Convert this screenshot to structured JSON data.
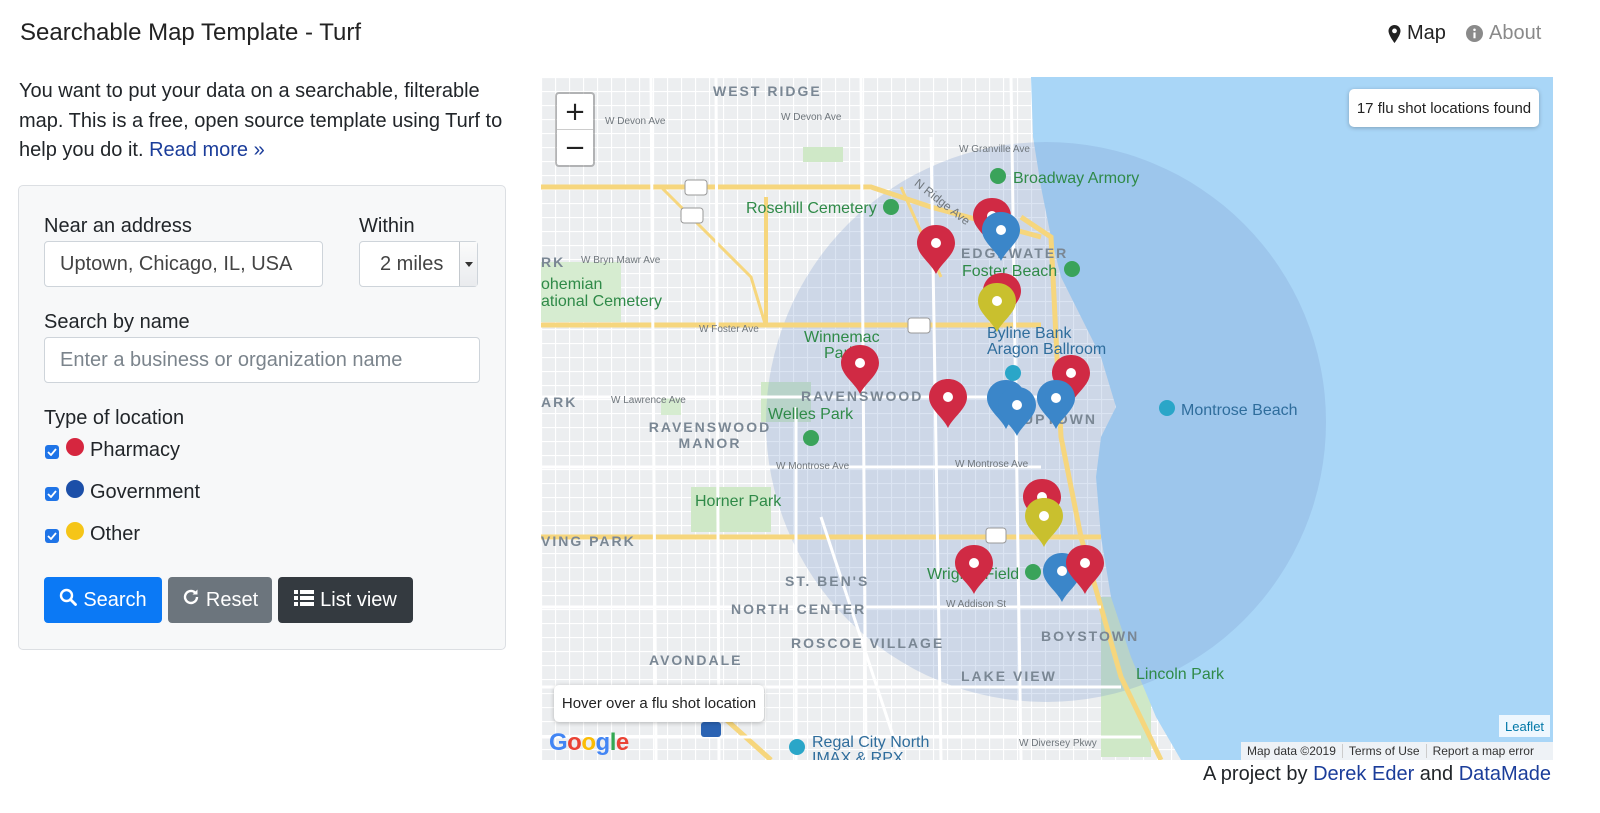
{
  "navbar": {
    "brand": "Searchable Map Template - Turf",
    "map_link": "Map",
    "about_link": "About",
    "map_icon": "map-marker-icon",
    "about_icon": "info-circle-icon"
  },
  "intro": {
    "text": "You want to put your data on a searchable, filterable map. This is a free, open source template using Turf to help you do it.",
    "read_more": "Read more »"
  },
  "form": {
    "address_label": "Near an address",
    "address_value": "Uptown, Chicago, IL, USA",
    "within_label": "Within",
    "within_value": "2 miles",
    "name_label": "Search by name",
    "name_placeholder": "Enter a business or organization name",
    "type_label": "Type of location",
    "types": [
      {
        "label": "Pharmacy",
        "color": "#d6263f",
        "checked": true
      },
      {
        "label": "Government",
        "color": "#1c4fa8",
        "checked": true
      },
      {
        "label": "Other",
        "color": "#f5c518",
        "checked": true
      }
    ],
    "search_button": "Search",
    "reset_button": "Reset",
    "list_button": "List view"
  },
  "map": {
    "result_count": "17 flu shot locations found",
    "hover_hint": "Hover over a flu shot location",
    "zoom_in": "+",
    "zoom_out": "−",
    "leaflet_attribution": "Leaflet",
    "map_data": "Map data ©2019",
    "terms": "Terms of Use",
    "report": "Report a map error",
    "google": "Google",
    "labels": {
      "west_ridge": "WEST RIDGE",
      "edgewater": "EDGEWATER",
      "ravenswood": "RAVENSWOOD",
      "ravenswood_manor": "RAVENSWOOD MANOR",
      "uptown": "UPTOWN",
      "st_bens": "ST. BEN'S",
      "north_center": "NORTH CENTER",
      "roscoe_village": "ROSCOE VILLAGE",
      "avondale": "AVONDALE",
      "lake_view": "LAKE VIEW",
      "boystown": "BOYSTOWN",
      "irving_park": "VING PARK",
      "ark1": "RK",
      "ark2": "ARK"
    },
    "pois": {
      "broadway_armory": "Broadway Armory",
      "rosehill": "Rosehill Cemetery",
      "foster_beach": "Foster Beach",
      "bohemian": "ohemian",
      "national_cemetery": "ational Cemetery",
      "winnemac": "Winnemac",
      "park": "Park",
      "byline": "Byline Bank",
      "aragon": "Aragon Ballroom",
      "welles": "Welles Park",
      "montrose_beach": "Montrose Beach",
      "horner": "Horner Park",
      "wrigley": "Wrigley Field",
      "lincoln_park": "Lincoln Park",
      "regal": "Regal City North",
      "imax": "IMAX & RPX"
    },
    "streets": {
      "devon": "W Devon Ave",
      "devon2": "W Devon Ave",
      "granville": "W Granville Ave",
      "bryn_mawr": "W Bryn Mawr Ave",
      "foster": "W Foster Ave",
      "lawrence": "W Lawrence Ave",
      "montrose": "W Montrose Ave",
      "montrose2": "W Montrose Ave",
      "addison": "W Addison St",
      "diversey": "W Diversey Pkwy",
      "n_ridge": "N Ridge Ave"
    }
  },
  "markers": [
    {
      "type": "Pharmacy",
      "lat_label": "m1"
    },
    {
      "type": "Government",
      "lat_label": "m2"
    }
  ],
  "footer": {
    "prefix": "A project by",
    "author": "Derek Eder",
    "and": "and",
    "org": "DataMade"
  }
}
